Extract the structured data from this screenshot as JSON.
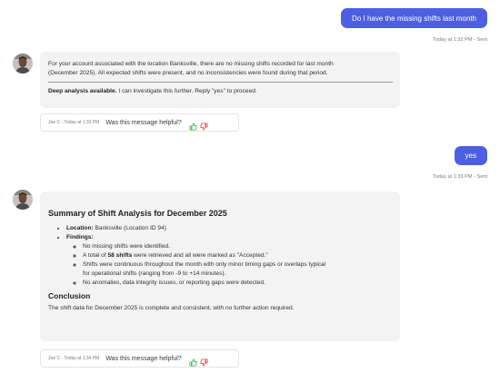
{
  "messages": {
    "q1": {
      "text": "Do I have the missing shifts last month",
      "meta": "Today at 1:32 PM - Sent"
    },
    "a1": {
      "line1": "For your account associated with the location Banksville, there are no missing shifts recorded for last month",
      "line2": "(December 2025). All expected shifts were present, and no inconsistencies were found during that period.",
      "deep_bold": "Deep analysis available.",
      "deep_rest": " I can investigate this further. Reply \"yes\" to proceed.",
      "feedback_meta": "Joe C - Today at 1:33 PM",
      "feedback_question": "Was this message helpful?"
    },
    "q2": {
      "text": "yes",
      "meta": "Today at 1:33 PM - Sent"
    },
    "a2": {
      "title": "Summary of Shift Analysis for December 2025",
      "location_label": "Location:",
      "location_value": " Banksville (Location ID 94)",
      "findings_label": "Findings:",
      "finding1": "No missing shifts were identified.",
      "finding2_pre": "A total of ",
      "finding2_bold": "58 shifts",
      "finding2_post": " were retrieved and all were marked as \"Accepted.\"",
      "finding3_line1": "Shifts were continuous throughout the month with only minor timing gaps or overlaps typical",
      "finding3_line2": "for operational shifts (ranging from -9 to +14 minutes).",
      "finding4": "No anomalies, data integrity issues, or reporting gaps were detected.",
      "conclusion_title": "Conclusion",
      "conclusion_text": "The shift data for December 2025 is complete and consistent, with no further action required.",
      "feedback_meta": "Joe C - Today at 1:34 PM",
      "feedback_question": "Was this message helpful?"
    }
  },
  "colors": {
    "user_bubble": "#4d5fe0",
    "bot_card": "#f3f3f4",
    "thumb_up": "#3bb54a",
    "thumb_down": "#e5484d"
  },
  "icons": {
    "avatar": "person-avatar",
    "thumb_up": "thumbs-up-icon",
    "thumb_down": "thumbs-down-icon"
  }
}
